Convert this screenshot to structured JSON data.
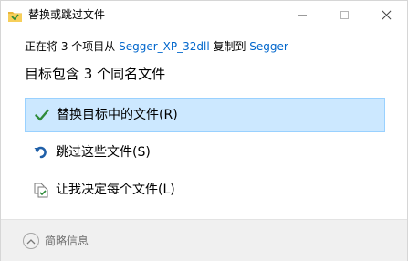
{
  "window": {
    "title": "替换或跳过文件"
  },
  "info": {
    "prefix": "正在将 3 个项目从 ",
    "source": "Segger_XP_32dll",
    "middle": " 复制到 ",
    "destination": "Segger"
  },
  "heading": "目标包含 3 个同名文件",
  "options": [
    {
      "label": "替换目标中的文件(R)",
      "icon": "checkmark-icon"
    },
    {
      "label": "跳过这些文件(S)",
      "icon": "skip-arrow-icon"
    },
    {
      "label": "让我决定每个文件(L)",
      "icon": "decide-files-icon"
    }
  ],
  "footer": {
    "label": "简略信息"
  },
  "colors": {
    "selected_bg": "#cce8ff",
    "selected_border": "#99d1ff",
    "link": "#0066cc",
    "check_green": "#2e8b3a",
    "skip_blue": "#1f5fa8"
  }
}
